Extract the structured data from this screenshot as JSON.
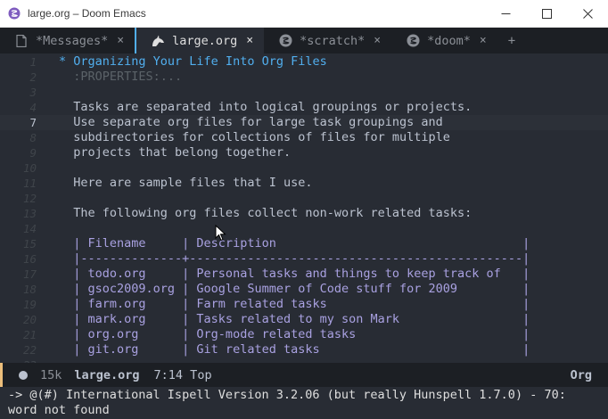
{
  "window": {
    "title": "large.org – Doom Emacs"
  },
  "tabs": [
    {
      "label": "*Messages*",
      "icon": "document-icon",
      "active": false
    },
    {
      "label": "large.org",
      "icon": "org-unicorn-icon",
      "active": true
    },
    {
      "label": "*scratch*",
      "icon": "emacs-icon",
      "active": false
    },
    {
      "label": "*doom*",
      "icon": "emacs-icon",
      "active": false
    }
  ],
  "tab_close_glyph": "×",
  "tab_new_glyph": "+",
  "editor": {
    "current_line": 7,
    "lines": [
      {
        "n": "1",
        "text": "* Organizing Your Life Into Org Files",
        "kind": "heading"
      },
      {
        "n": "2",
        "text": "  :PROPERTIES:...",
        "kind": "drawer"
      },
      {
        "n": "3",
        "text": "",
        "kind": "text"
      },
      {
        "n": "4",
        "text": "  Tasks are separated into logical groupings or projects.",
        "kind": "text"
      },
      {
        "n": "7",
        "text": "  Use separate org files for large task groupings and",
        "kind": "text"
      },
      {
        "n": "8",
        "text": "  subdirectories for collections of files for multiple",
        "kind": "text"
      },
      {
        "n": "9",
        "text": "  projects that belong together.",
        "kind": "text"
      },
      {
        "n": "10",
        "text": "",
        "kind": "text"
      },
      {
        "n": "11",
        "text": "  Here are sample files that I use.",
        "kind": "text"
      },
      {
        "n": "12",
        "text": "",
        "kind": "text"
      },
      {
        "n": "13",
        "text": "  The following org files collect non-work related tasks:",
        "kind": "text"
      },
      {
        "n": "14",
        "text": "",
        "kind": "text"
      },
      {
        "n": "15",
        "text": "  | Filename     | Description                                  |",
        "kind": "table"
      },
      {
        "n": "16",
        "text": "  |--------------+----------------------------------------------|",
        "kind": "table"
      },
      {
        "n": "17",
        "text": "  | todo.org     | Personal tasks and things to keep track of   |",
        "kind": "table"
      },
      {
        "n": "18",
        "text": "  | gsoc2009.org | Google Summer of Code stuff for 2009         |",
        "kind": "table"
      },
      {
        "n": "19",
        "text": "  | farm.org     | Farm related tasks                           |",
        "kind": "table"
      },
      {
        "n": "20",
        "text": "  | mark.org     | Tasks related to my son Mark                 |",
        "kind": "table"
      },
      {
        "n": "21",
        "text": "  | org.org      | Org-mode related tasks                       |",
        "kind": "table"
      },
      {
        "n": "22",
        "text": "  | git.org      | Git related tasks                            |",
        "kind": "table"
      },
      {
        "n": "23",
        "text": "",
        "kind": "text"
      }
    ]
  },
  "modeline": {
    "size": "15k",
    "buffer": "large.org",
    "position": "7:14 Top",
    "mode": "Org"
  },
  "echo": {
    "line1": "-> @(#) International Ispell Version 3.2.06 (but really Hunspell 1.7.0) - 70:",
    "line2": "word not found"
  },
  "colors": {
    "background": "#282c34",
    "tabbar": "#1c1f24",
    "heading": "#51afef",
    "table": "#a9a1e1",
    "text": "#bbc2cf",
    "modeline_accent": "#ecbe7b"
  }
}
